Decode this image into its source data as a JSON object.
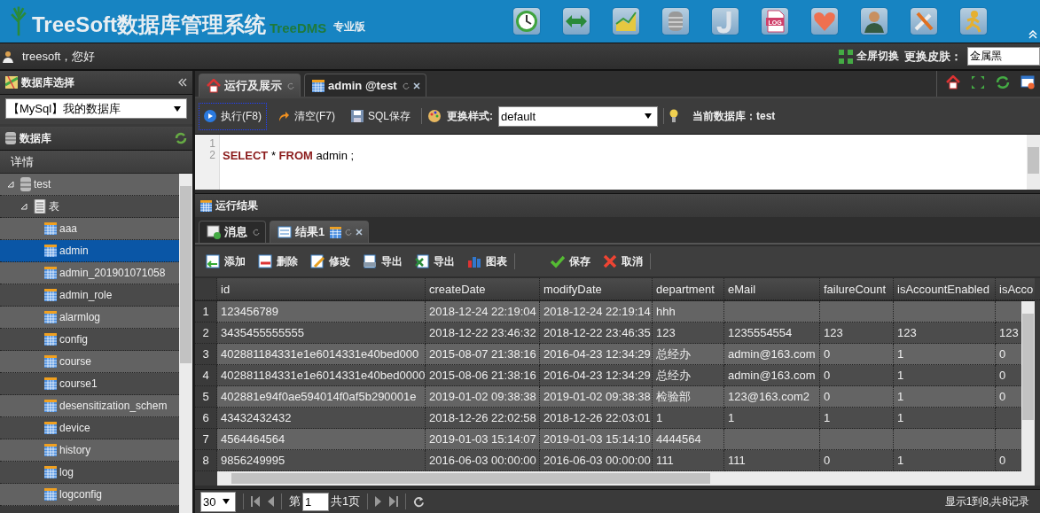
{
  "header": {
    "title": "TreeSoft数据库管理系统",
    "subtitle": "TreeDMS",
    "edition": "专业版",
    "apps": [
      {
        "kind": "clock"
      },
      {
        "kind": "arrows"
      },
      {
        "kind": "chart"
      },
      {
        "kind": "database"
      },
      {
        "kind": "hook"
      },
      {
        "kind": "log",
        "label": "LOG"
      },
      {
        "kind": "heart"
      },
      {
        "kind": "person"
      },
      {
        "kind": "tools"
      },
      {
        "kind": "runner"
      }
    ]
  },
  "userbar": {
    "greeting": "treesoft，您好",
    "fullscreen": "全屏切换",
    "skin_label": "更换皮肤：",
    "skin_value": "金属黑"
  },
  "sidebar": {
    "db_select_title": "数据库选择",
    "db_select_value": "【MySql】我的数据库",
    "db_title": "数据库",
    "details_header": "详情",
    "tree": [
      {
        "label": "test",
        "kind": "database",
        "expanded": true,
        "selected": false,
        "children": [
          {
            "label": "表",
            "kind": "folder",
            "expanded": true,
            "selected": false,
            "children": [
              {
                "label": "aaa",
                "kind": "table",
                "selected": false
              },
              {
                "label": "admin",
                "kind": "table",
                "selected": true
              },
              {
                "label": "admin_201901071058",
                "kind": "table",
                "selected": false
              },
              {
                "label": "admin_role",
                "kind": "table",
                "selected": false
              },
              {
                "label": "alarmlog",
                "kind": "table",
                "selected": false
              },
              {
                "label": "config",
                "kind": "table",
                "selected": false
              },
              {
                "label": "course",
                "kind": "table",
                "selected": false
              },
              {
                "label": "course1",
                "kind": "table",
                "selected": false
              },
              {
                "label": "desensitization_schem",
                "kind": "table",
                "selected": false
              },
              {
                "label": "device",
                "kind": "table",
                "selected": false
              },
              {
                "label": "history",
                "kind": "table",
                "selected": false
              },
              {
                "label": "log",
                "kind": "table",
                "selected": false
              },
              {
                "label": "logconfig",
                "kind": "table",
                "selected": false
              }
            ]
          }
        ]
      }
    ]
  },
  "tabs": [
    {
      "label": "运行及展示",
      "kind": "home",
      "closable": false,
      "selected": true
    },
    {
      "label": "admin @test",
      "kind": "table",
      "closable": true,
      "selected": false
    }
  ],
  "sql_toolbar": {
    "buttons": [
      {
        "label": "执行(F8)",
        "kind": "run",
        "focused": true
      },
      {
        "label": "清空(F7)",
        "kind": "clear",
        "focused": false
      },
      {
        "label": "SQL保存",
        "kind": "save",
        "focused": false
      }
    ],
    "style_label": "更换样式:",
    "style_value": "default",
    "current_db": "当前数据库：test"
  },
  "editor": {
    "lines": [
      {
        "number": "1"
      },
      {
        "number": "2",
        "code": "**SELECT** * **FROM** admin ;"
      }
    ]
  },
  "results": {
    "title": "运行结果",
    "tabs": [
      {
        "label": "消息",
        "kind": "message",
        "closable": false,
        "selected": false
      },
      {
        "label": "结果1",
        "kind": "result",
        "closable": true,
        "selected": true
      }
    ],
    "actions": [
      {
        "label": "添加",
        "kind": "add"
      },
      {
        "label": "删除",
        "kind": "delete"
      },
      {
        "label": "修改",
        "kind": "edit"
      },
      {
        "label": "导出",
        "kind": "export"
      },
      {
        "label": "导出",
        "kind": "excel"
      },
      {
        "label": "图表",
        "kind": "chart"
      },
      {
        "label": "保存",
        "kind": "save"
      },
      {
        "label": "取消",
        "kind": "cancel"
      }
    ]
  },
  "grid": {
    "columns": [
      "id",
      "createDate",
      "modifyDate",
      "department",
      "eMail",
      "failureCount",
      "isAccountEnabled",
      "isAcco"
    ],
    "rows": [
      {
        "number": "1",
        "cells": [
          "123456789",
          "2018-12-24 22:19:04",
          "2018-12-24 22:19:14",
          "hhh",
          "",
          "",
          "",
          ""
        ]
      },
      {
        "number": "2",
        "cells": [
          "3435455555555",
          "2018-12-22 23:46:32",
          "2018-12-22 23:46:35",
          "123",
          "1235554554",
          "123",
          "123",
          "123"
        ]
      },
      {
        "number": "3",
        "cells": [
          "402881184331e1e6014331e40bed000",
          "2015-08-07 21:38:16",
          "2016-04-23 12:34:29",
          "总经办",
          "admin@163.com",
          "0",
          "1",
          "0"
        ]
      },
      {
        "number": "4",
        "cells": [
          "402881184331e1e6014331e40bed0000",
          "2015-08-06 21:38:16",
          "2016-04-23 12:34:29",
          "总经办",
          "admin@163.com",
          "0",
          "1",
          "0"
        ]
      },
      {
        "number": "5",
        "cells": [
          "402881e94f0ae594014f0af5b290001e",
          "2019-01-02 09:38:38",
          "2019-01-02 09:38:38",
          "检验部",
          "123@163.com2",
          "0",
          "1",
          "0"
        ]
      },
      {
        "number": "6",
        "cells": [
          "43432432432",
          "2018-12-26 22:02:58",
          "2018-12-26 22:03:01",
          "1",
          "1",
          "1",
          "1",
          ""
        ]
      },
      {
        "number": "7",
        "cells": [
          "4564464564",
          "2019-01-03 15:14:07",
          "2019-01-03 15:14:10",
          "4444564",
          "",
          "",
          "",
          ""
        ]
      },
      {
        "number": "8",
        "cells": [
          "9856249995",
          "2016-06-03 00:00:00",
          "2016-06-03 00:00:00",
          "111",
          "111",
          "0",
          "1",
          "0"
        ]
      }
    ]
  },
  "pager": {
    "page_size": "30",
    "page_label": "第",
    "page": "1",
    "total_pages": "共1页",
    "summary": "显示1到8,共8记录"
  }
}
